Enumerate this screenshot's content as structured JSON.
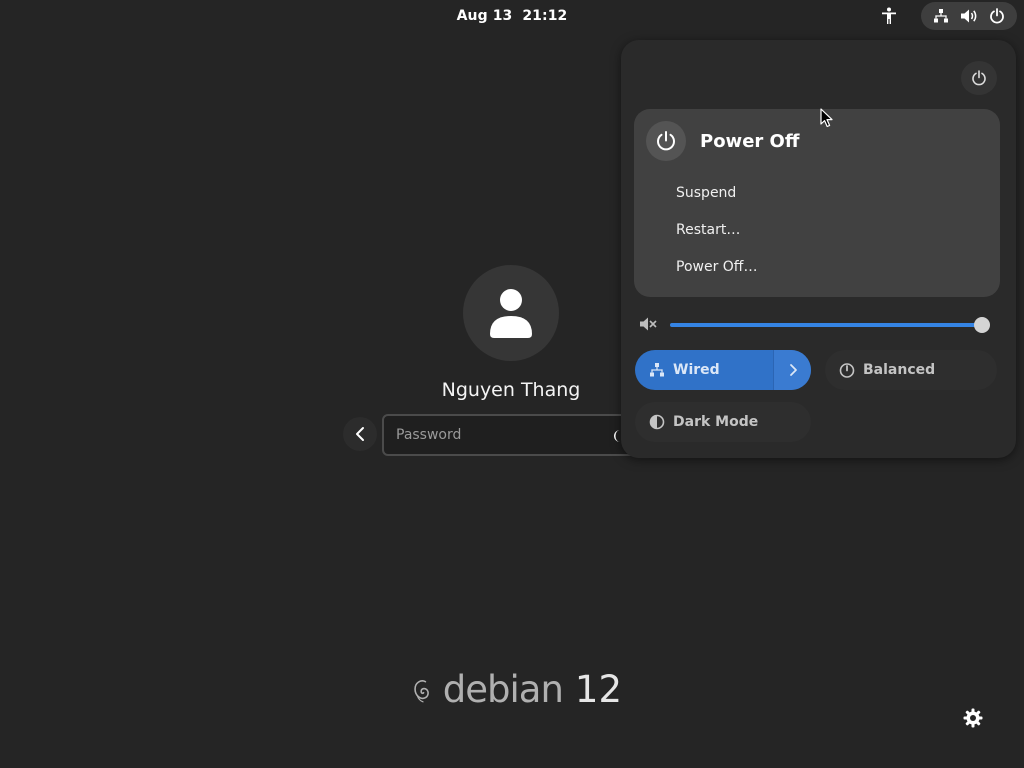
{
  "topbar": {
    "date": "Aug 13",
    "time": "21:12",
    "icons": [
      "accessibility-icon",
      "network-wired-icon",
      "volume-icon",
      "power-icon"
    ]
  },
  "login": {
    "username": "Nguyen Thang",
    "password_placeholder": "Password",
    "password_value": ""
  },
  "branding": {
    "logo_word": "debian",
    "version": "12"
  },
  "quick_settings": {
    "power_menu": {
      "title": "Power Off",
      "items": [
        "Suspend",
        "Restart…",
        "Power Off…"
      ]
    },
    "volume": {
      "muted": true,
      "level": 1.0
    },
    "toggles": {
      "network": {
        "label": "Wired",
        "active": true
      },
      "power_profile": {
        "label": "Balanced",
        "active": false
      },
      "dark_mode": {
        "label": "Dark Mode",
        "active": false
      }
    }
  },
  "colors": {
    "background": "#252525",
    "panel": "#2a2a2a",
    "menu": "#414141",
    "accent": "#3584e4"
  }
}
